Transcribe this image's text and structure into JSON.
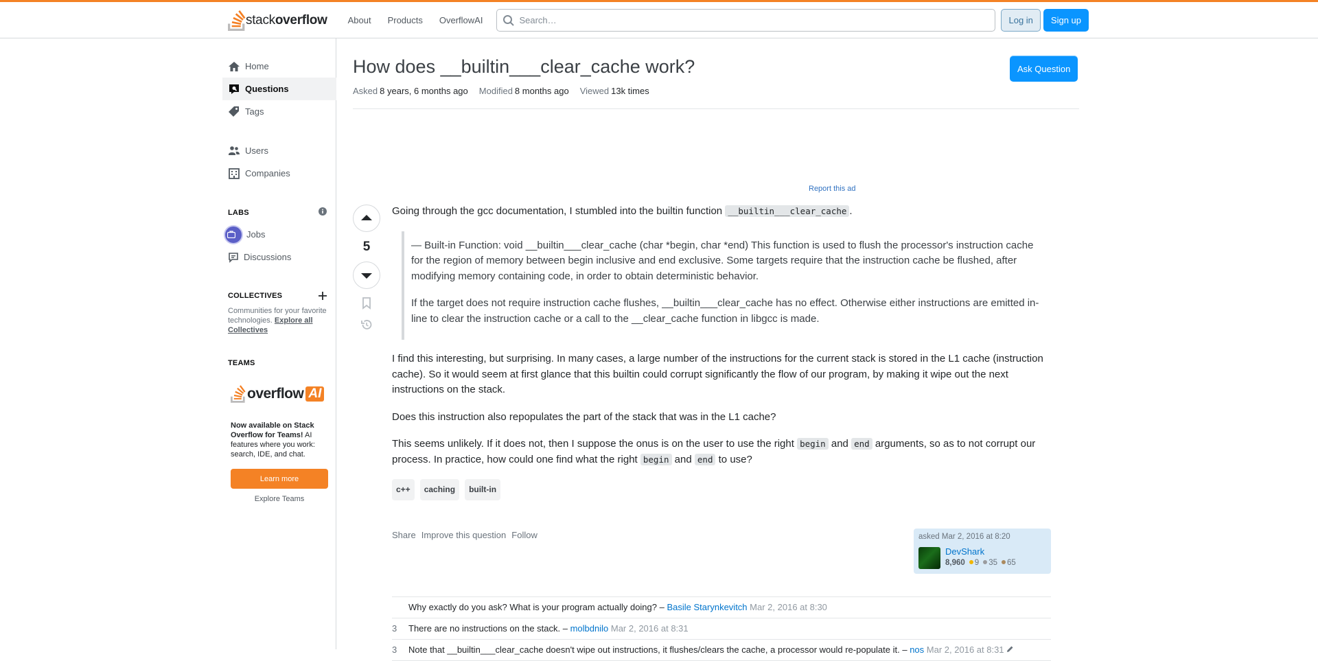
{
  "header": {
    "logo_text_light": "stack",
    "logo_text_bold": "overflow",
    "nav": [
      "About",
      "Products",
      "OverflowAI"
    ],
    "search_placeholder": "Search…",
    "login_label": "Log in",
    "signup_label": "Sign up",
    "accent_color": "#f48225"
  },
  "sidebar": {
    "items": [
      {
        "label": "Home",
        "icon": "home-icon"
      },
      {
        "label": "Questions",
        "icon": "questions-icon",
        "active": true
      },
      {
        "label": "Tags",
        "icon": "tag-icon"
      },
      {
        "label": "Users",
        "icon": "users-icon"
      },
      {
        "label": "Companies",
        "icon": "companies-icon"
      }
    ],
    "labs_heading": "LABS",
    "labs_items": [
      {
        "label": "Jobs",
        "icon": "briefcase-icon"
      },
      {
        "label": "Discussions",
        "icon": "discussions-icon"
      }
    ],
    "collectives_heading": "COLLECTIVES",
    "collectives_text": "Communities for your favorite technologies.",
    "collectives_link": "Explore all Collectives",
    "teams_heading": "TEAMS",
    "teams_logo_text": "overflow",
    "teams_logo_badge": "AI",
    "teams_text_bold": "Now available on Stack Overflow for Teams!",
    "teams_text": "AI features where you work: search, IDE, and chat.",
    "learn_more": "Learn more",
    "explore_teams": "Explore Teams"
  },
  "question": {
    "title": "How does __builtin___clear_cache work?",
    "ask_button": "Ask Question",
    "asked_label": "Asked",
    "asked_value": "8 years, 6 months ago",
    "modified_label": "Modified",
    "modified_value": "8 months ago",
    "viewed_label": "Viewed",
    "viewed_value": "13k times",
    "report_ad": "Report this ad",
    "score": "5",
    "body": {
      "p1_text": "Going through the gcc documentation, I stumbled into the builtin function ",
      "p1_code": "__builtin___clear_cache",
      "p1_end": ".",
      "quote1": "— Built-in Function: void __builtin___clear_cache (char *begin, char *end) This function is used to flush the processor's instruction cache for the region of memory between begin inclusive and end exclusive. Some targets require that the instruction cache be flushed, after modifying memory containing code, in order to obtain deterministic behavior.",
      "quote2": "If the target does not require instruction cache flushes, __builtin___clear_cache has no effect. Otherwise either instructions are emitted in-line to clear the instruction cache or a call to the __clear_cache function in libgcc is made.",
      "p2": "I find this interesting, but surprising. In many cases, a large number of the instructions for the current stack is stored in the L1 cache (instruction cache). So it would seem at first glance that this builtin could corrupt significantly the flow of our program, by making it wipe out the next instructions on the stack.",
      "p3": "Does this instruction also repopulates the part of the stack that was in the L1 cache?",
      "p4_a": "This seems unlikely. If it does not, then I suppose the onus is on the user to use the right ",
      "p4_code1": "begin",
      "p4_b": " and ",
      "p4_code2": "end",
      "p4_c": " arguments, so as to not corrupt our process. In practice, how could one find what the right ",
      "p4_code3": "begin",
      "p4_d": " and ",
      "p4_code4": "end",
      "p4_e": " to use?"
    },
    "tags": [
      "c++",
      "caching",
      "built-in"
    ],
    "actions": [
      "Share",
      "Improve this question",
      "Follow"
    ],
    "owner": {
      "asked": "asked Mar 2, 2016 at 8:20",
      "name": "DevShark",
      "reputation": "8,960",
      "gold": "9",
      "silver": "35",
      "bronze": "65"
    }
  },
  "comments": [
    {
      "score": "",
      "text": "Why exactly do you ask? What is your program actually doing?",
      "user": "Basile Starynkevitch",
      "date": "Mar 2, 2016 at 8:30"
    },
    {
      "score": "3",
      "text": "There are no instructions on the stack.",
      "user": "molbdnilo",
      "date": "Mar 2, 2016 at 8:31"
    },
    {
      "score": "3",
      "text": "Note that __builtin___clear_cache doesn't wipe out instructions, it flushes/clears the cache, a processor would re-populate it.",
      "user": "nos",
      "date": "Mar 2, 2016 at 8:31"
    }
  ]
}
